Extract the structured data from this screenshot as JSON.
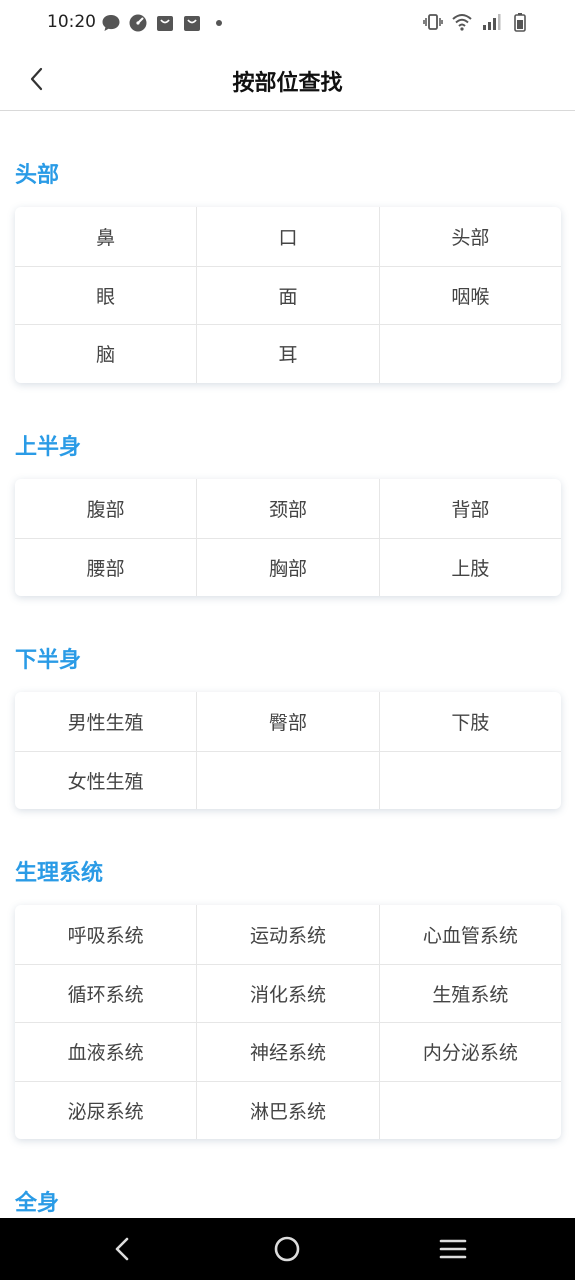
{
  "status": {
    "time": "10:20",
    "left_icons": [
      "chat-bubble-icon",
      "speed-gauge-icon",
      "shopping-bag-icon",
      "shopping-bag-icon",
      "dot-icon"
    ],
    "right_icons": [
      "vibrate-icon",
      "wifi-icon",
      "signal-icon",
      "battery-icon"
    ]
  },
  "nav": {
    "title": "按部位查找",
    "back_icon": "chevron-left-icon"
  },
  "sections": [
    {
      "title": "头部",
      "rows": [
        [
          "鼻",
          "口",
          "头部"
        ],
        [
          "眼",
          "面",
          "咽喉"
        ],
        [
          "脑",
          "耳",
          ""
        ]
      ]
    },
    {
      "title": "上半身",
      "rows": [
        [
          "腹部",
          "颈部",
          "背部"
        ],
        [
          "腰部",
          "胸部",
          "上肢"
        ]
      ]
    },
    {
      "title": "下半身",
      "rows": [
        [
          "男性生殖",
          "臀部",
          "下肢"
        ],
        [
          "女性生殖",
          "",
          ""
        ]
      ]
    },
    {
      "title": "生理系统",
      "rows": [
        [
          "呼吸系统",
          "运动系统",
          "心血管系统"
        ],
        [
          "循环系统",
          "消化系统",
          "生殖系统"
        ],
        [
          "血液系统",
          "神经系统",
          "内分泌系统"
        ],
        [
          "泌尿系统",
          "淋巴系统",
          ""
        ]
      ]
    },
    {
      "title": "全身",
      "rows": []
    }
  ],
  "system_nav": [
    "back-triangle-icon",
    "home-circle-icon",
    "recents-menu-icon"
  ],
  "colors": {
    "accent": "#2a9be6",
    "card_border": "#e6e6e6",
    "bottom_bar": "#000000"
  }
}
